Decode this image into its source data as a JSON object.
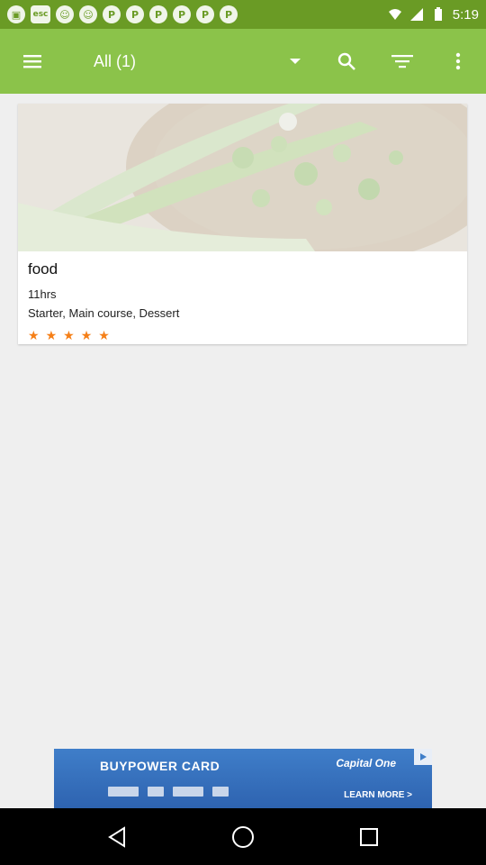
{
  "status_bar": {
    "time": "5:19",
    "notification_icons": [
      "app-icon",
      "esc-icon",
      "cat-icon",
      "cat-icon",
      "pinterest-icon",
      "pinterest-icon",
      "pinterest-icon",
      "pinterest-icon",
      "pinterest-icon",
      "pinterest-icon"
    ],
    "esc_label": "esc"
  },
  "app_bar": {
    "title": "All (1)",
    "background": "#8bc34a",
    "status_background": "#6a9b25"
  },
  "recipe": {
    "title": "food",
    "time": "11hrs",
    "categories": "Starter, Main course, Dessert",
    "rating": 5,
    "rating_max": 5,
    "star_color": "#f57f17"
  },
  "ad": {
    "title": "BUYPOWER CARD",
    "brand": "Capital One",
    "cta": "LEARN MORE >",
    "logos": [
      "Chevrolet",
      "Buick",
      "GMC",
      "Cadillac"
    ]
  }
}
